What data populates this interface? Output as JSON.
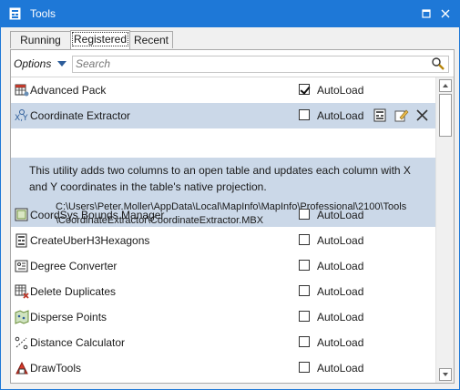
{
  "window": {
    "title": "Tools"
  },
  "tabs": [
    {
      "label": "Running"
    },
    {
      "label": "Registered"
    },
    {
      "label": "Recent"
    }
  ],
  "toolbar": {
    "options_label": "Options",
    "search_placeholder": "Search"
  },
  "selected_tool": {
    "description": "This utility adds two columns to an open table and updates each column with X and Y coordinates in the table's native projection.",
    "path_line1": "C:\\Users\\Peter.Moller\\AppData\\Local\\MapInfo\\MapInfo\\Professional\\2100\\Tools",
    "path_line2": "\\CoordinateExtractor\\CoordinateExtractor.MBX"
  },
  "tools": [
    {
      "name": "Advanced Pack",
      "autoload_label": "AutoLoad",
      "autoload": true,
      "icon": "table-gear-icon"
    },
    {
      "name": "Coordinate Extractor",
      "autoload_label": "AutoLoad",
      "autoload": false,
      "icon": "xy-coordinate-icon"
    },
    {
      "name": "CoordSys Bounds Manager",
      "autoload_label": "AutoLoad",
      "autoload": false,
      "icon": "bounds-icon"
    },
    {
      "name": "CreateUberH3Hexagons",
      "autoload_label": "AutoLoad",
      "autoload": false,
      "icon": "tool-icon"
    },
    {
      "name": "Degree Converter",
      "autoload_label": "AutoLoad",
      "autoload": false,
      "icon": "degree-icon"
    },
    {
      "name": "Delete Duplicates",
      "autoload_label": "AutoLoad",
      "autoload": false,
      "icon": "delete-duplicates-icon"
    },
    {
      "name": "Disperse Points",
      "autoload_label": "AutoLoad",
      "autoload": false,
      "icon": "disperse-points-icon"
    },
    {
      "name": "Distance Calculator",
      "autoload_label": "AutoLoad",
      "autoload": false,
      "icon": "distance-icon"
    },
    {
      "name": "DrawTools",
      "autoload_label": "AutoLoad",
      "autoload": false,
      "icon": "draw-tools-icon"
    }
  ],
  "colors": {
    "titlebar": "#1e78d7",
    "selected_row": "#cbd8e8",
    "accent": "#2d5d9a"
  }
}
